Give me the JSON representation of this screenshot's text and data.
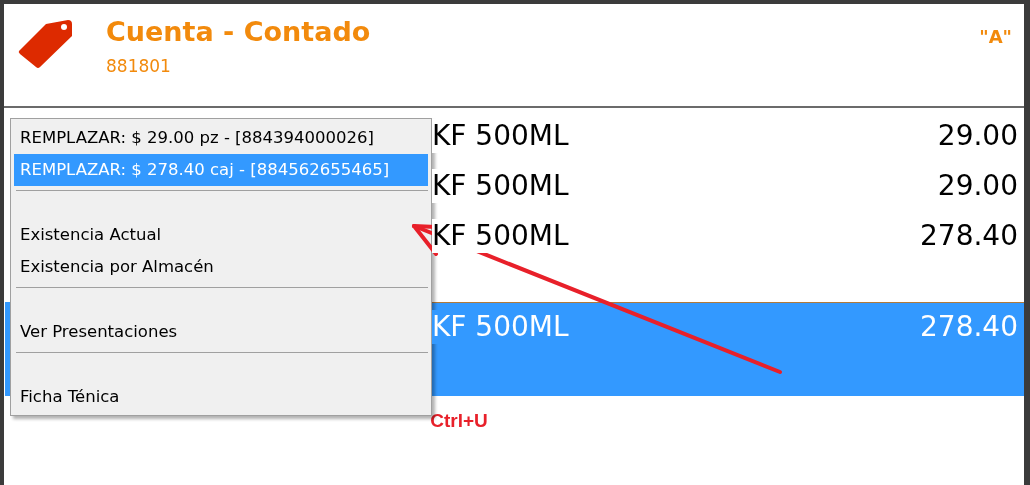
{
  "header": {
    "title": "Cuenta - Contado",
    "subtitle": "881801",
    "badge": "\"A\""
  },
  "rows": [
    {
      "name": "KF 500ML",
      "price": "29.00",
      "selected": false
    },
    {
      "name": "KF 500ML",
      "price": "29.00",
      "selected": false
    },
    {
      "name": "KF 500ML",
      "price": "278.40",
      "selected": false
    },
    {
      "name": "KF 500ML",
      "price": "278.40",
      "selected": true
    }
  ],
  "context_menu": [
    {
      "kind": "option",
      "label": "REMPLAZAR: $ 29.00 pz - [884394000026]",
      "selected": false
    },
    {
      "kind": "option",
      "label": "REMPLAZAR: $ 278.40 caj - [884562655465]",
      "selected": true
    },
    {
      "kind": "separator"
    },
    {
      "kind": "option",
      "label": "Existencia Actual",
      "selected": false
    },
    {
      "kind": "option",
      "label": "Existencia por Almacén",
      "selected": false
    },
    {
      "kind": "separator"
    },
    {
      "kind": "option",
      "label": "Ver Presentaciones",
      "selected": false
    },
    {
      "kind": "separator"
    },
    {
      "kind": "option",
      "label": "Ficha Ténica",
      "selected": false
    }
  ],
  "annotation": {
    "shortcut": "Ctrl+U"
  }
}
